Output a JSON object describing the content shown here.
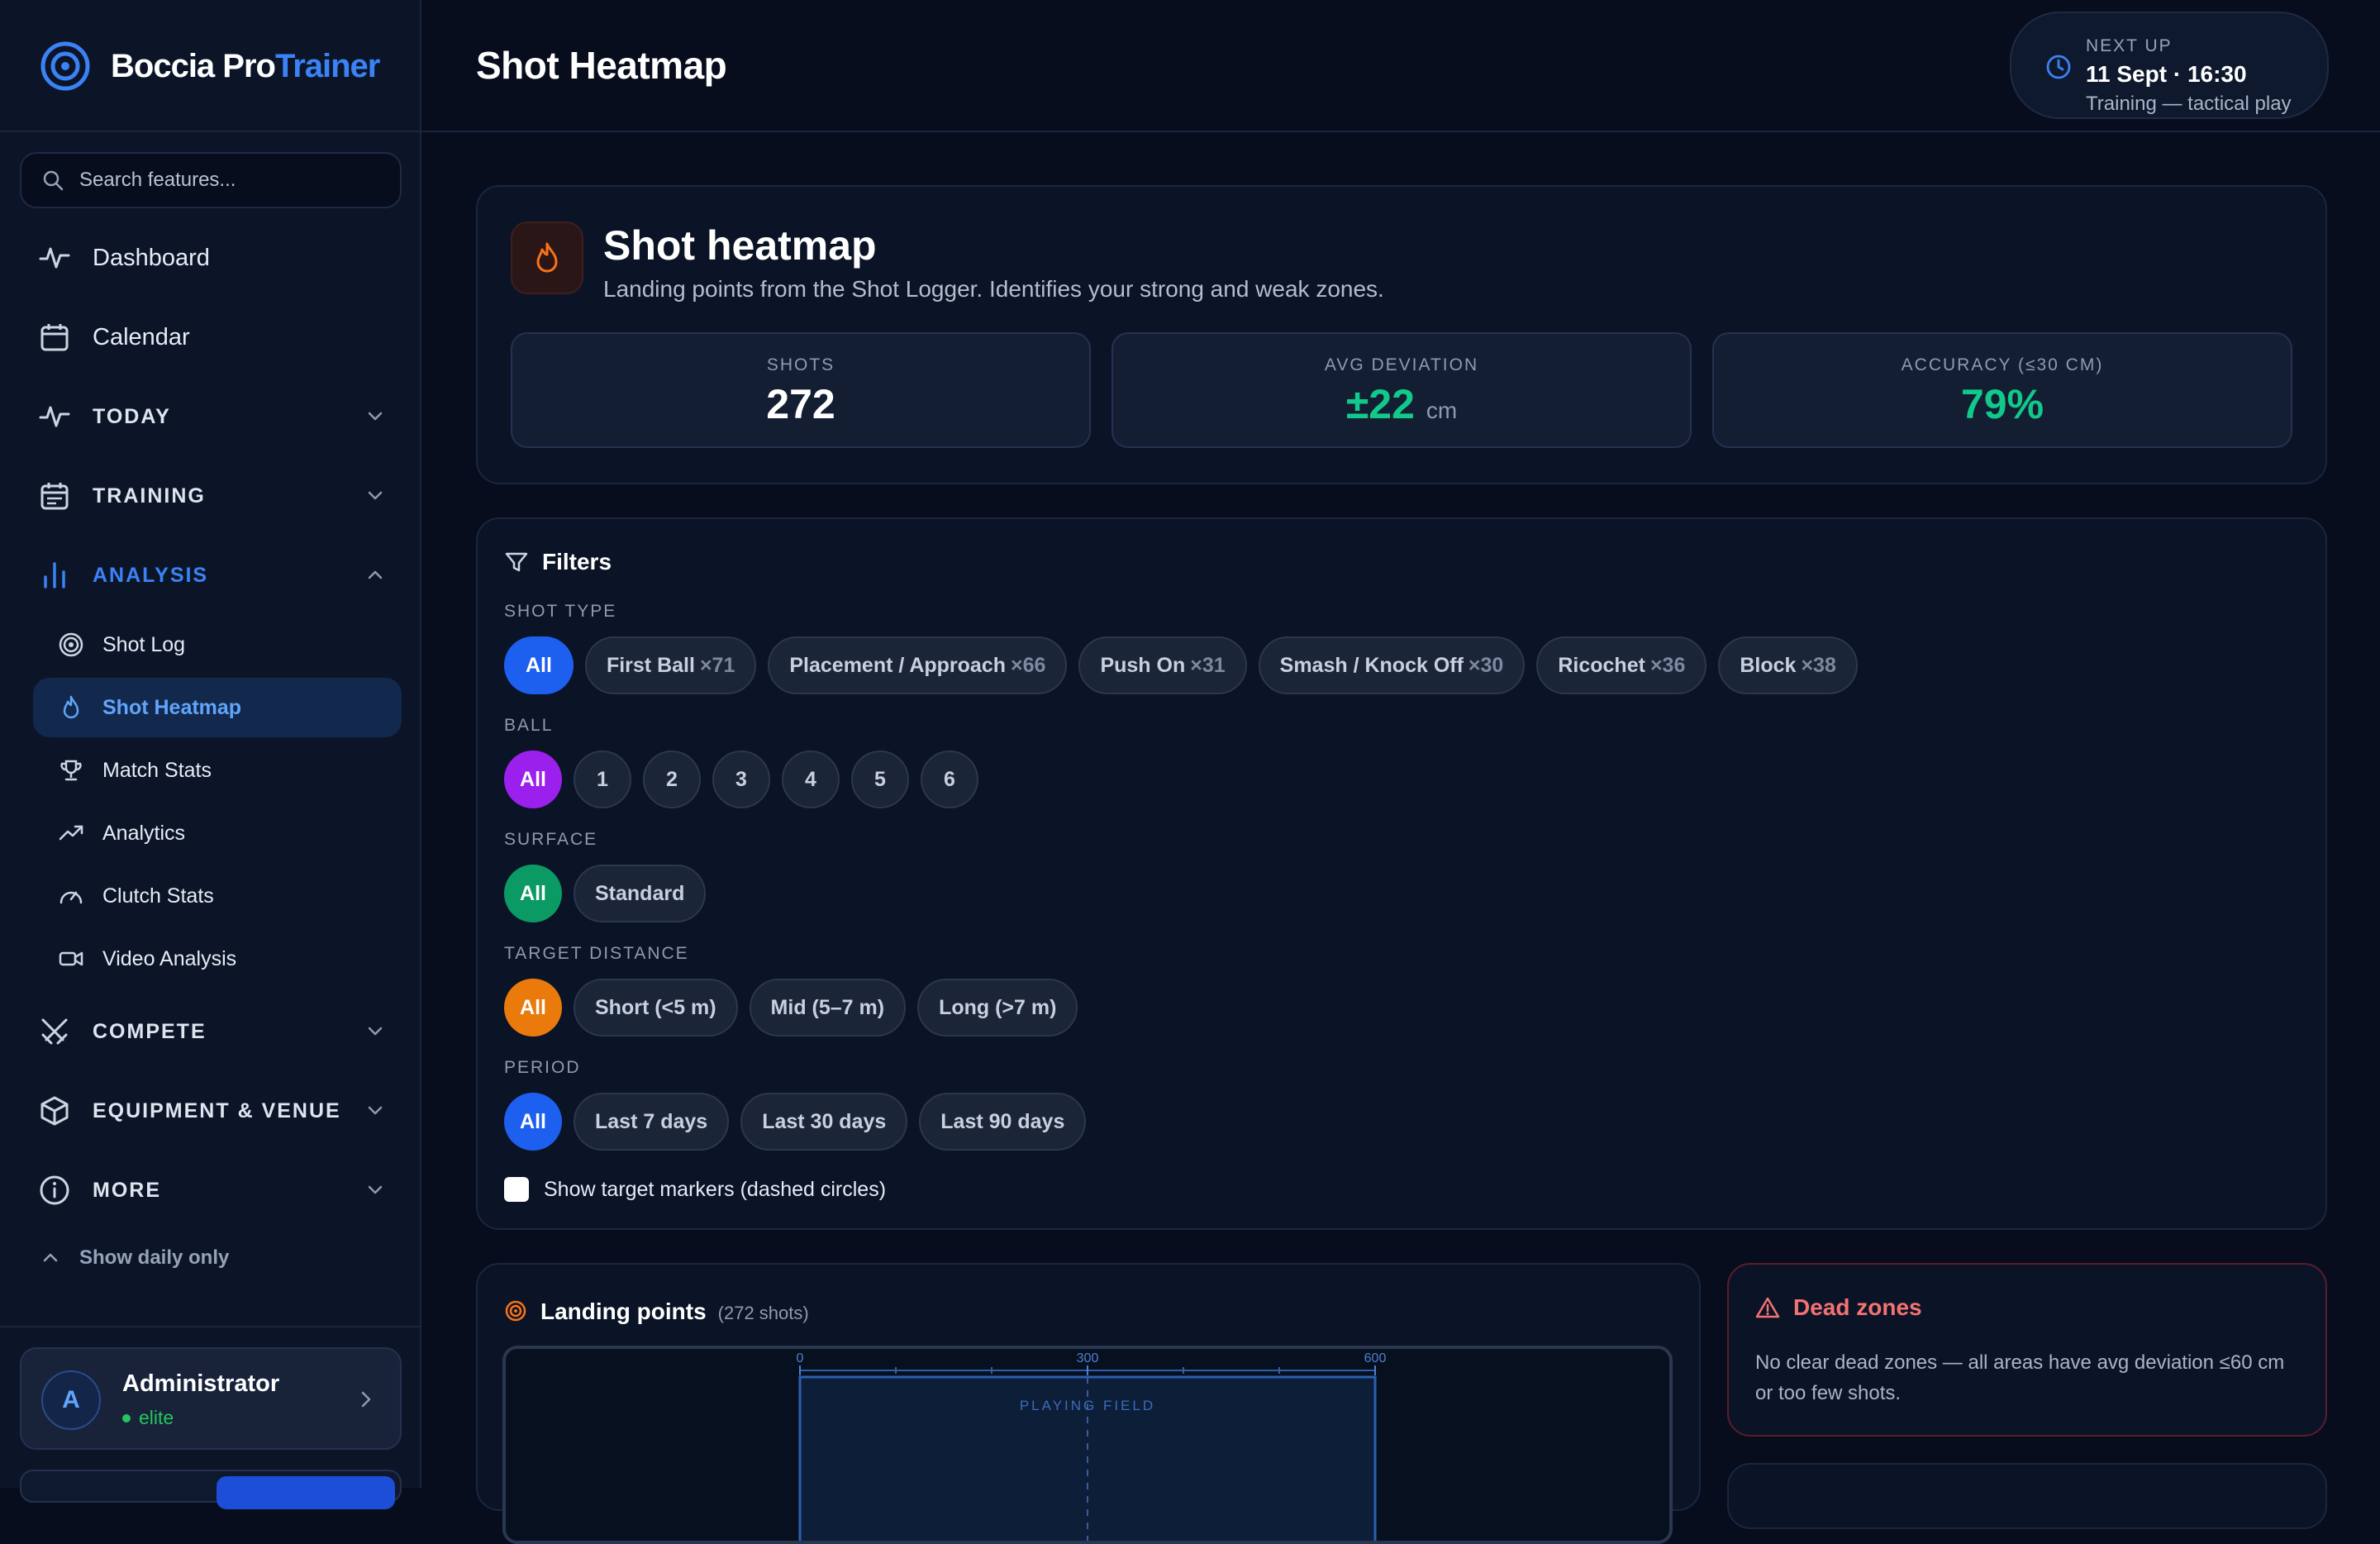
{
  "app": {
    "brand_main": "Boccia Pro",
    "brand_accent": "Trainer"
  },
  "search": {
    "placeholder": "Search features..."
  },
  "nav": {
    "dashboard": "Dashboard",
    "calendar": "Calendar",
    "today": "TODAY",
    "training": "TRAINING",
    "analysis": "ANALYSIS",
    "analysis_items": [
      "Shot Log",
      "Shot Heatmap",
      "Match Stats",
      "Analytics",
      "Clutch Stats",
      "Video Analysis"
    ],
    "active_item": "Shot Heatmap",
    "compete": "COMPETE",
    "equipment": "EQUIPMENT & VENUE",
    "more": "MORE",
    "show_daily": "Show daily only"
  },
  "user": {
    "initial": "A",
    "name": "Administrator",
    "status": "elite"
  },
  "header": {
    "title": "Shot Heatmap"
  },
  "next_up": {
    "label": "NEXT UP",
    "date": "11 Sept · 16:30",
    "subtitle": "Training — tactical play"
  },
  "hero": {
    "title": "Shot heatmap",
    "subtitle": "Landing points from the Shot Logger. Identifies your strong and weak zones.",
    "stats": {
      "shots": {
        "label": "SHOTS",
        "value": "272"
      },
      "deviation": {
        "label": "AVG DEVIATION",
        "value": "±22",
        "unit": "cm"
      },
      "accuracy": {
        "label": "ACCURACY (≤30 CM)",
        "value": "79%"
      }
    }
  },
  "filters": {
    "title": "Filters",
    "shot_type": {
      "label": "SHOT TYPE",
      "options": [
        {
          "name": "All",
          "count": ""
        },
        {
          "name": "First Ball",
          "count": "×71"
        },
        {
          "name": "Placement / Approach",
          "count": "×66"
        },
        {
          "name": "Push On",
          "count": "×31"
        },
        {
          "name": "Smash / Knock Off",
          "count": "×30"
        },
        {
          "name": "Ricochet",
          "count": "×36"
        },
        {
          "name": "Block",
          "count": "×38"
        }
      ]
    },
    "ball": {
      "label": "BALL",
      "options": [
        "All",
        "1",
        "2",
        "3",
        "4",
        "5",
        "6"
      ]
    },
    "surface": {
      "label": "SURFACE",
      "options": [
        "All",
        "Standard"
      ]
    },
    "distance": {
      "label": "TARGET DISTANCE",
      "options": [
        "All",
        "Short (<5 m)",
        "Mid (5–7 m)",
        "Long (>7 m)"
      ]
    },
    "period": {
      "label": "PERIOD",
      "options": [
        "All",
        "Last 7 days",
        "Last 30 days",
        "Last 90 days"
      ]
    },
    "target_markers": {
      "label": "Show target markers (dashed circles)",
      "checked": false
    }
  },
  "landing": {
    "title": "Landing points",
    "count": "(272 shots)",
    "axis_ticks": [
      "0",
      "300",
      "600"
    ],
    "field_label": "PLAYING FIELD"
  },
  "dead_zones": {
    "title": "Dead zones",
    "text": "No clear dead zones — all areas have avg deviation ≤60 cm or too few shots."
  },
  "colors": {
    "accent": "#3b82f6",
    "positive": "#10c98a",
    "sel_blue": "#1d60f0",
    "sel_purple": "#9b20ee",
    "sel_green": "#0b9a63",
    "sel_orange": "#ea7a0c",
    "danger": "#f47272"
  }
}
